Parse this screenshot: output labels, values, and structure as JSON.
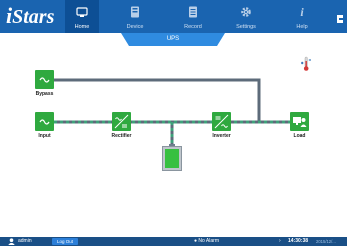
{
  "app": {
    "brand_i": "i",
    "brand_rest": "Stars"
  },
  "nav": {
    "tabs": [
      {
        "label": "Home",
        "icon": "monitor-icon"
      },
      {
        "label": "Device",
        "icon": "device-icon"
      },
      {
        "label": "Record",
        "icon": "record-icon"
      },
      {
        "label": "Settings",
        "icon": "gear-icon"
      },
      {
        "label": "Help",
        "icon": "help-icon"
      }
    ]
  },
  "page": {
    "title": "UPS"
  },
  "diagram": {
    "bypass": "Bypass",
    "input": "Input",
    "rectifier": "Rectifier",
    "inverter": "Inverter",
    "load": "Load",
    "battery_level_percent": 100
  },
  "statusbar": {
    "user": "admin",
    "logout": "Log Out",
    "alarm": "No Alarm",
    "time": "14:30:38",
    "date": "2015/12/..."
  },
  "colors": {
    "brand_blue": "#1a64b0",
    "active_tab": "#0d4f95",
    "block_green": "#2fa93f",
    "line_gray": "#5d6b7a",
    "line_dash": "#3fa07a"
  }
}
